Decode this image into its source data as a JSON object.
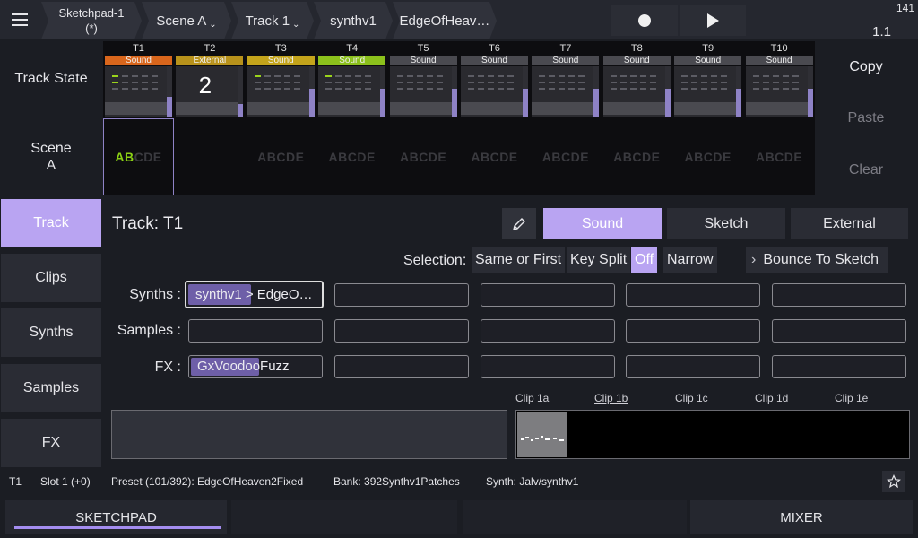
{
  "header": {
    "breadcrumbs": [
      {
        "label": "Sketchpad-1",
        "sub": "(*)"
      },
      {
        "label": "Scene A",
        "caret": "⌄"
      },
      {
        "label": "Track 1",
        "caret": "⌄"
      },
      {
        "label": "synthv1"
      },
      {
        "label": "EdgeOfHeav…"
      }
    ],
    "bpm": "141",
    "bar_position": "1.1"
  },
  "labels": {
    "track_state": "Track State",
    "scene_line1": "Scene",
    "scene_line2": "A"
  },
  "tracks": [
    {
      "name": "T1",
      "type": "Sound",
      "type_color": "#d9661c",
      "scene_on": "AB",
      "scene_off": "CDE",
      "fill_percent": 40
    },
    {
      "name": "T2",
      "type": "External",
      "type_color": "#b8921b",
      "big": "2",
      "scene_on": "",
      "scene_off": "",
      "fill_percent": 25
    },
    {
      "name": "T3",
      "type": "Sound",
      "type_color": "#c4a41b",
      "scene_on": "",
      "scene_off": "ABCDE",
      "fill_percent": 55
    },
    {
      "name": "T4",
      "type": "Sound",
      "type_color": "#8cc11c",
      "scene_on": "",
      "scene_off": "ABCDE",
      "fill_percent": 55
    },
    {
      "name": "T5",
      "type": "Sound",
      "type_color": "#4a4a50",
      "scene_on": "",
      "scene_off": "ABCDE",
      "fill_percent": 55
    },
    {
      "name": "T6",
      "type": "Sound",
      "type_color": "#4a4a50",
      "scene_on": "",
      "scene_off": "ABCDE",
      "fill_percent": 55
    },
    {
      "name": "T7",
      "type": "Sound",
      "type_color": "#4a4a50",
      "scene_on": "",
      "scene_off": "ABCDE",
      "fill_percent": 55
    },
    {
      "name": "T8",
      "type": "Sound",
      "type_color": "#4a4a50",
      "scene_on": "",
      "scene_off": "ABCDE",
      "fill_percent": 55
    },
    {
      "name": "T9",
      "type": "Sound",
      "type_color": "#4a4a50",
      "scene_on": "",
      "scene_off": "ABCDE",
      "fill_percent": 55
    },
    {
      "name": "T10",
      "type": "Sound",
      "type_color": "#4a4a50",
      "scene_on": "",
      "scene_off": "ABCDE",
      "fill_percent": 55
    }
  ],
  "actions": {
    "copy": "Copy",
    "paste": "Paste",
    "clear": "Clear"
  },
  "nav": [
    "Track",
    "Clips",
    "Synths",
    "Samples",
    "FX"
  ],
  "panel": {
    "title": "Track: T1",
    "modes": [
      "Sound",
      "Sketch",
      "External"
    ],
    "selection_label": "Selection:",
    "selection_options": [
      "Same or First",
      "Key Split",
      "Off",
      "Narrow"
    ],
    "bounce": "Bounce To Sketch",
    "synths_label": "Synths :",
    "samples_label": "Samples :",
    "fx_label": "FX :",
    "synth_slot1": "synthv1 > EdgeO…",
    "fx_slot1": "GxVoodooFuzz",
    "clips": [
      "Clip 1a",
      "Clip 1b",
      "Clip 1c",
      "Clip 1d",
      "Clip 1e"
    ]
  },
  "status": {
    "track": "T1",
    "slot": "Slot 1 (+0)",
    "preset": "Preset (101/392): EdgeOfHeaven2Fixed",
    "bank": "Bank: 392Synthv1Patches",
    "synth": "Synth: Jalv/synthv1"
  },
  "footer": {
    "sketchpad": "SKETCHPAD",
    "mixer": "MIXER"
  },
  "colors": {
    "accent": "#b9a4f2",
    "active_scene": "#8ad014"
  }
}
